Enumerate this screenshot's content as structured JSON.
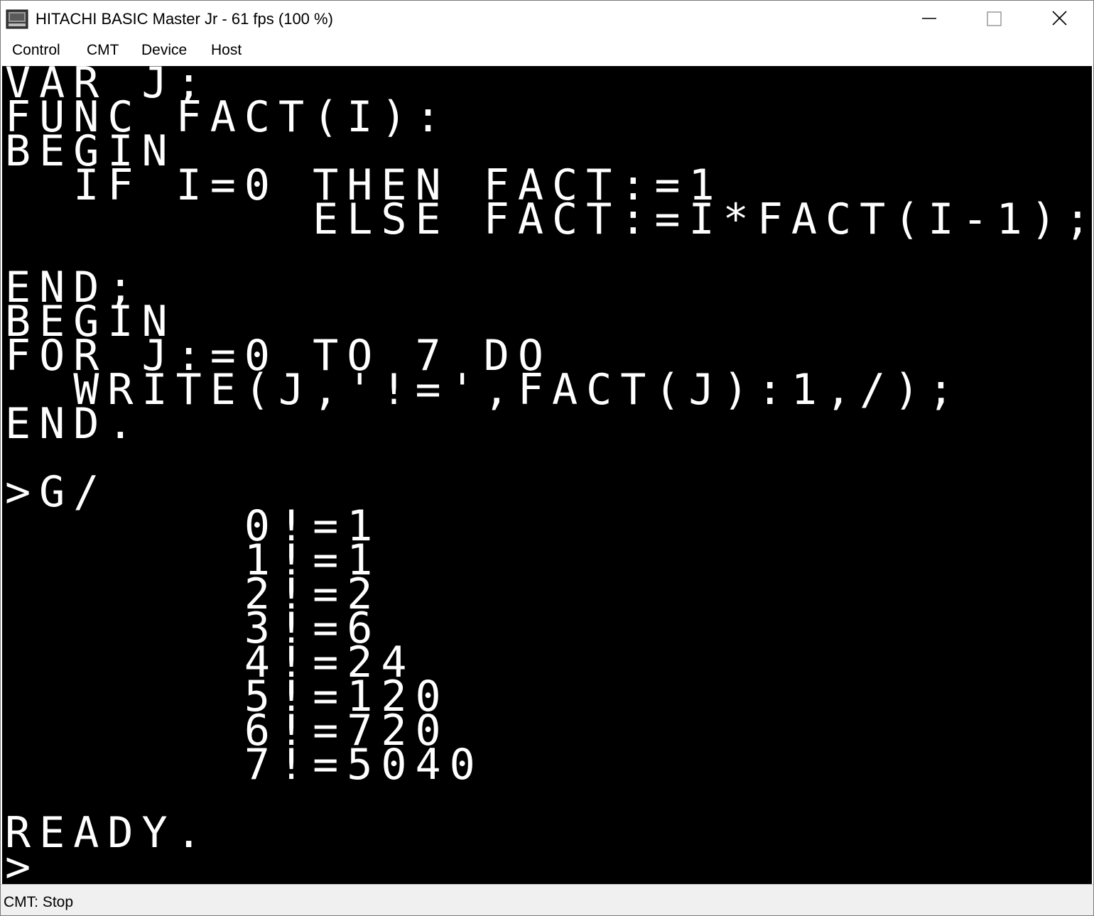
{
  "window": {
    "title": "HITACHI BASIC Master Jr - 61 fps (100 %)",
    "icon": "app-monitor-icon"
  },
  "menu": {
    "items": [
      "Control",
      "CMT",
      "Device",
      "Host"
    ]
  },
  "screen": {
    "lines": [
      "VAR J;",
      "FUNC FACT(I):",
      "BEGIN",
      "  IF I=0 THEN FACT:=1",
      "         ELSE FACT:=I*FACT(I-1);",
      "",
      "END;",
      "BEGIN",
      "FOR J:=0 TO 7 DO",
      "  WRITE(J,'!=',FACT(J):1,/);",
      "END.",
      "",
      ">G/",
      "       0!=1",
      "       1!=1",
      "       2!=2",
      "       3!=6",
      "       4!=24",
      "       5!=120",
      "       6!=720",
      "       7!=5040",
      "",
      "READY.",
      ">_"
    ]
  },
  "status": {
    "text": "CMT: Stop"
  },
  "colors": {
    "screen_bg": "#000000",
    "screen_fg": "#ffffff",
    "status_bg": "#f0f0f0"
  }
}
